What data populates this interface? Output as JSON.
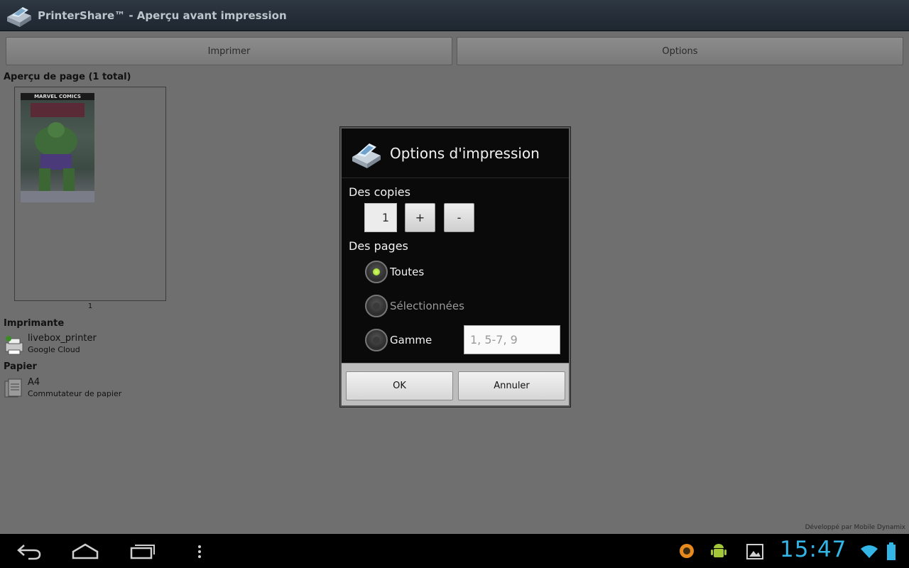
{
  "titlebar": {
    "app_icon": "printer-app-icon",
    "title": "PrinterShare™ - Aperçu avant impression"
  },
  "toolbar": {
    "print_label": "Imprimer",
    "options_label": "Options"
  },
  "preview": {
    "heading": "Aperçu de page (1 total)",
    "thumbnail_header": "MARVEL COMICS",
    "page_number": "1"
  },
  "printer": {
    "heading": "Imprimante",
    "icon": "printer-icon",
    "name": "livebox_printer",
    "type": "Google Cloud"
  },
  "paper": {
    "heading": "Papier",
    "icon": "paper-icon",
    "size": "A4",
    "subtitle": "Commutateur de papier"
  },
  "footer": {
    "credit": "Développé par Mobile Dynamix"
  },
  "dialog": {
    "icon": "printer-app-icon",
    "title": "Options d'impression",
    "copies_label": "Des copies",
    "copies_value": "1",
    "plus_label": "+",
    "minus_label": "-",
    "pages_label": "Des pages",
    "options": [
      {
        "label": "Toutes",
        "checked": true
      },
      {
        "label": "Sélectionnées",
        "checked": false,
        "disabled": true
      },
      {
        "label": "Gamme",
        "checked": false
      }
    ],
    "range_placeholder": "1, 5-7, 9",
    "ok_label": "OK",
    "cancel_label": "Annuler"
  },
  "statusbar": {
    "time": "15:47",
    "accent_color": "#33b5e5",
    "nav_icons": [
      "back-icon",
      "home-icon",
      "recent-apps-icon",
      "menu-icon"
    ],
    "notification_icons": [
      "orange-app-icon",
      "android-icon",
      "gallery-icon"
    ],
    "status_icons": [
      "wifi-icon",
      "battery-icon"
    ]
  }
}
